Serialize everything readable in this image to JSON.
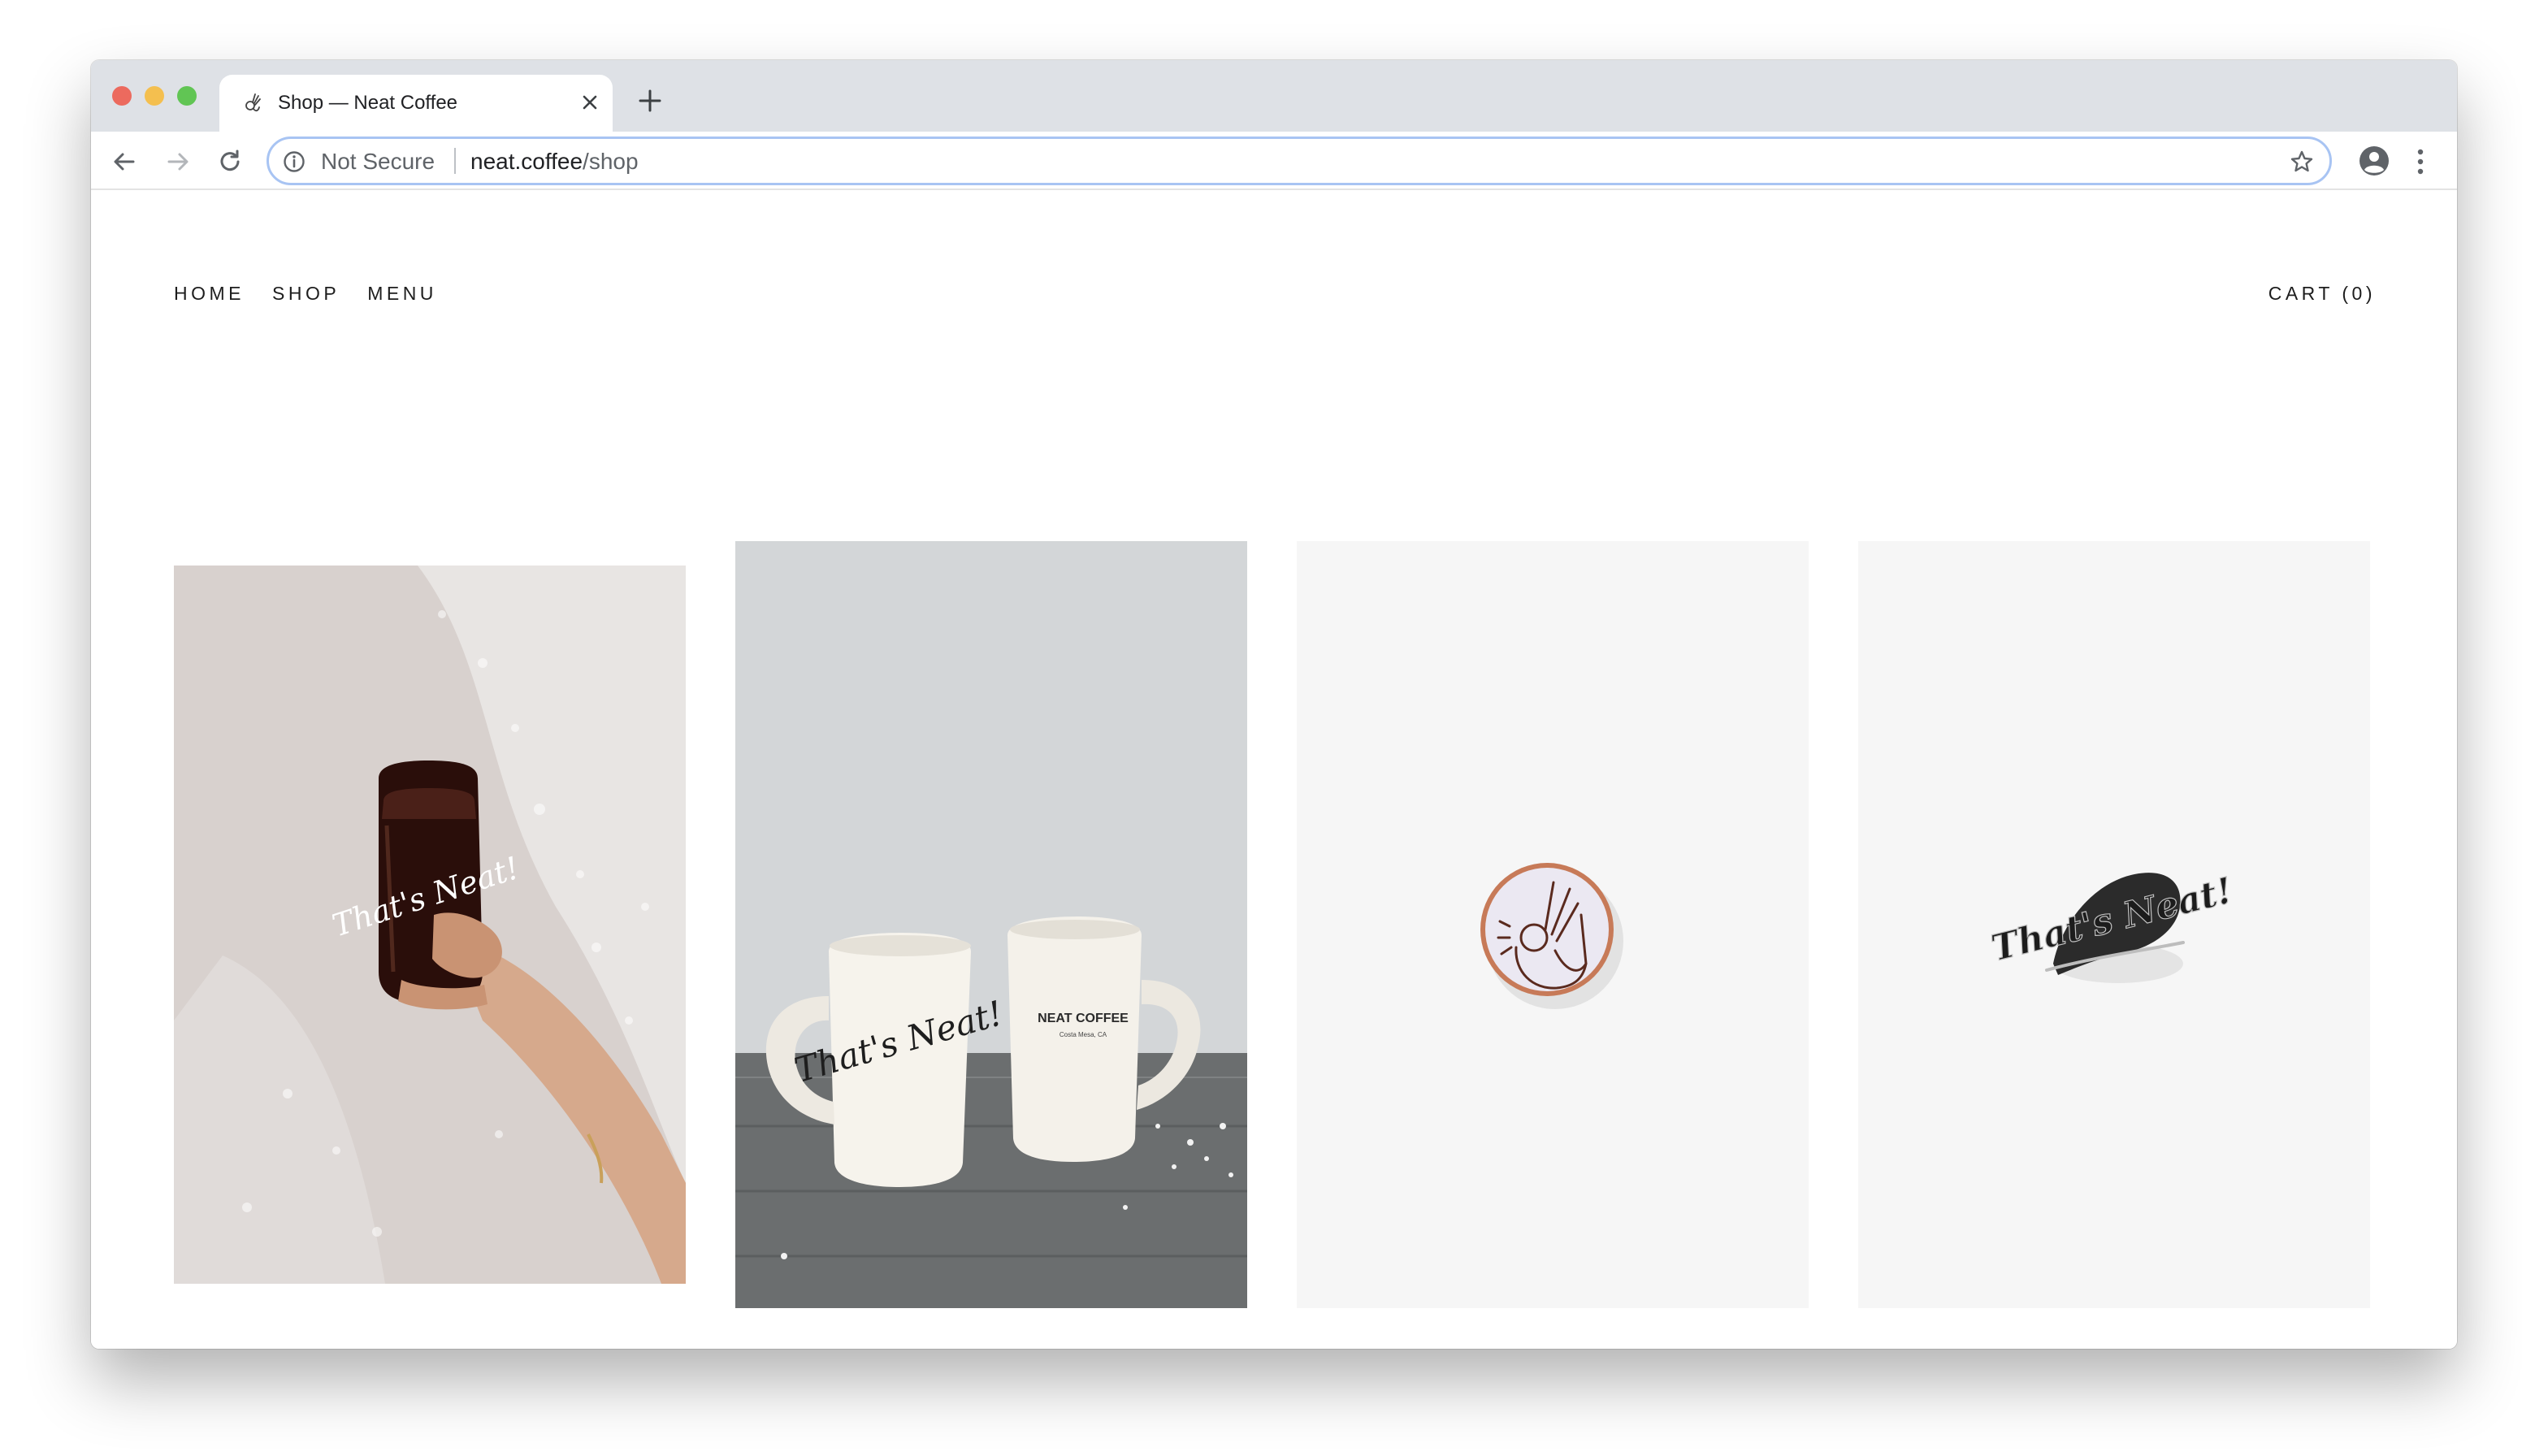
{
  "browser": {
    "tab": {
      "title": "Shop — Neat Coffee",
      "favicon": "ok-hand-icon"
    },
    "omnibox": {
      "security_label": "Not Secure",
      "url_host": "neat.coffee",
      "url_path": "/shop"
    },
    "icons": {
      "back": "arrow-left-icon",
      "forward": "arrow-right-icon",
      "reload": "reload-icon",
      "bookmark": "star-icon",
      "profile": "account-circle-icon",
      "menu": "more-vert-icon",
      "new_tab": "plus-icon",
      "close_tab": "close-icon",
      "info": "info-icon"
    }
  },
  "site": {
    "nav": [
      {
        "label": "HOME"
      },
      {
        "label": "SHOP"
      },
      {
        "label": "MENU"
      }
    ],
    "cart_label": "CART (0)"
  },
  "products": [
    {
      "image": "hand-holding-iced-coffee-glass",
      "glass_lettering": "That's Neat!"
    },
    {
      "image": "two-diner-mugs-on-table",
      "mug_left_lettering": "That's Neat!",
      "mug_right_lettering": "NEAT COFFEE",
      "mug_right_sublettering": "Costa Mesa, CA"
    },
    {
      "image": "ok-hand-enamel-pin"
    },
    {
      "image": "thats-neat-script-pin",
      "pin_lettering": "That's Neat!"
    }
  ]
}
